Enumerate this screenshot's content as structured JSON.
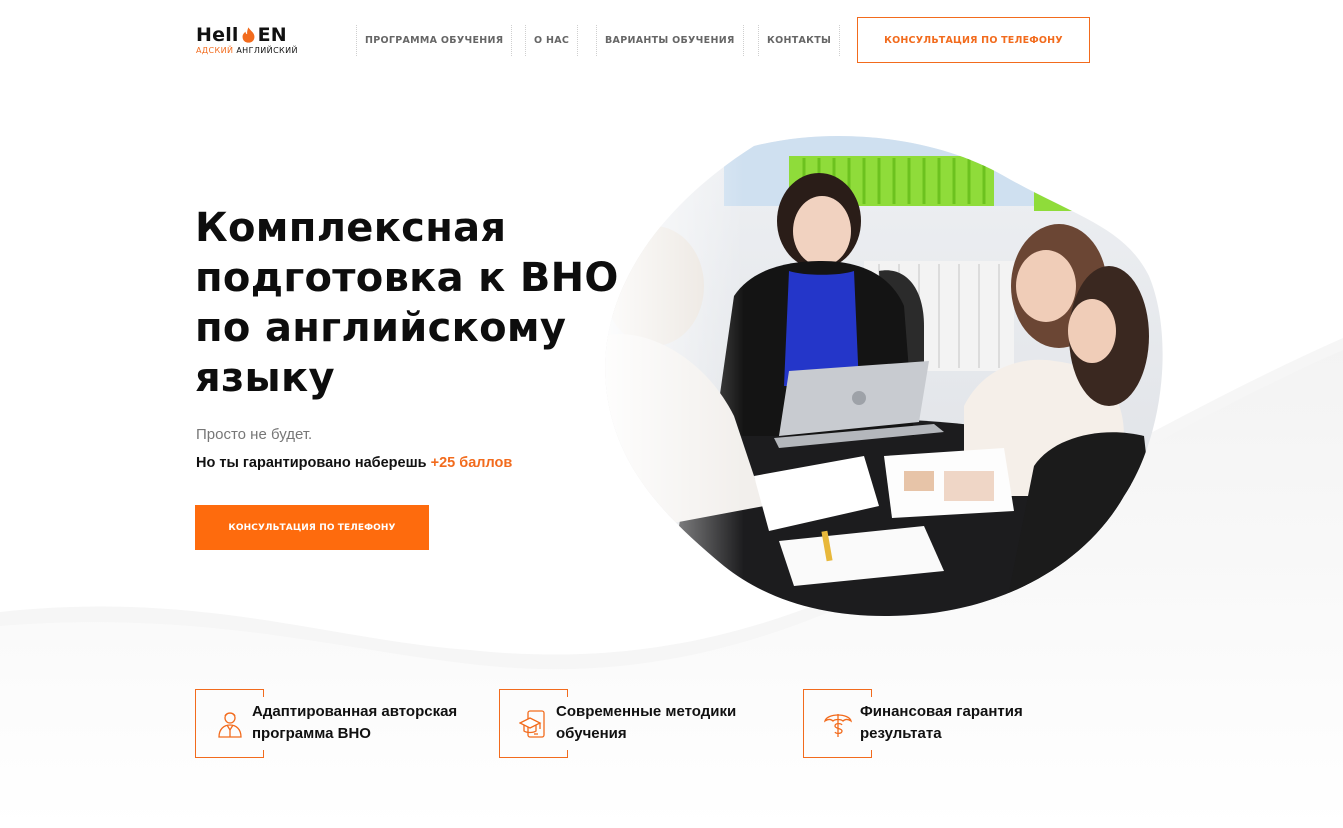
{
  "logo": {
    "main_prefix": "Hell",
    "main_suffix": "EN",
    "sub_accent": "АДСКИЙ",
    "sub_rest": "АНГЛИЙСКИЙ"
  },
  "nav": {
    "items": [
      {
        "label": "ПРОГРАММА ОБУЧЕНИЯ"
      },
      {
        "label": "О НАС"
      },
      {
        "label": "ВАРИАНТЫ ОБУЧЕНИЯ"
      },
      {
        "label": "КОНТАКТЫ"
      }
    ],
    "cta_label": "КОНСУЛЬТАЦИЯ ПО ТЕЛЕФОНУ"
  },
  "hero": {
    "title_lines": [
      "Комплексная",
      "подготовка к ВНО",
      "по английскому",
      "языку"
    ],
    "subtitle": "Просто не будет.",
    "guarantee_text": "Но ты гарантировано наберешь",
    "guarantee_accent": "+25 баллов",
    "cta_label": "КОНСУЛЬТАЦИЯ ПО ТЕЛЕФОНУ"
  },
  "features": [
    {
      "icon": "teacher-icon",
      "line1": "Адаптированная авторская",
      "line2": "программа ВНО"
    },
    {
      "icon": "graduation-device-icon",
      "line1": "Современные методики",
      "line2": "обучения"
    },
    {
      "icon": "money-umbrella-icon",
      "line1": "Финансовая гарантия",
      "line2": "результата"
    }
  ],
  "colors": {
    "accent": "#f26b1d",
    "button_fill": "#fe6b0d",
    "text": "#111111",
    "muted": "#777777"
  }
}
